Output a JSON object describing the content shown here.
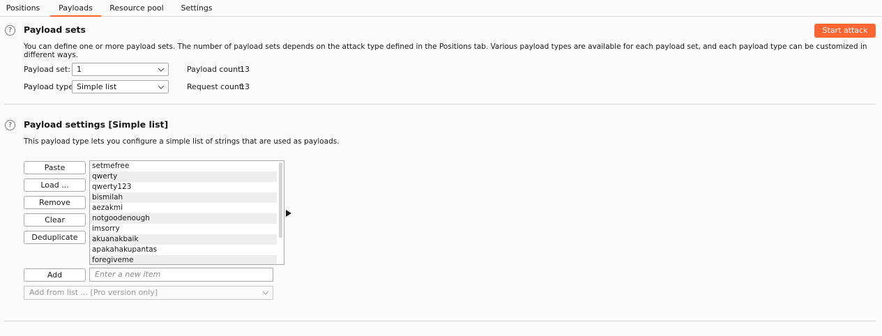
{
  "tabs": [
    {
      "label": "Positions"
    },
    {
      "label": "Payloads"
    },
    {
      "label": "Resource pool"
    },
    {
      "label": "Settings"
    }
  ],
  "payload_sets": {
    "title": "Payload sets",
    "description": "You can define one or more payload sets. The number of payload sets depends on the attack type defined in the Positions tab. Various payload types are available for each payload set, and each payload type can be customized in different ways.",
    "start_attack_label": "Start attack",
    "payload_set_label": "Payload set:",
    "payload_set_value": "1",
    "payload_type_label": "Payload type:",
    "payload_type_value": "Simple list",
    "payload_count_label": "Payload count:",
    "payload_count_value": "13",
    "request_count_label": "Request count:",
    "request_count_value": "13"
  },
  "payload_settings": {
    "title": "Payload settings [Simple list]",
    "description": "This payload type lets you configure a simple list of strings that are used as payloads.",
    "buttons": {
      "paste": "Paste",
      "load": "Load ...",
      "remove": "Remove",
      "clear": "Clear",
      "deduplicate": "Deduplicate",
      "add": "Add"
    },
    "items": [
      "setmefree",
      "qwerty",
      "qwerty123",
      "bismilah",
      "aezakmi",
      "notgoodenough",
      "imsorry",
      "akuanakbaik",
      "apakahakupantas",
      "foregiveme"
    ],
    "new_item_placeholder": "Enter a new item",
    "add_from_list": "Add from list ... [Pro version only]"
  },
  "icons": {
    "help": "?"
  },
  "colors": {
    "accent": "#ff6633"
  }
}
